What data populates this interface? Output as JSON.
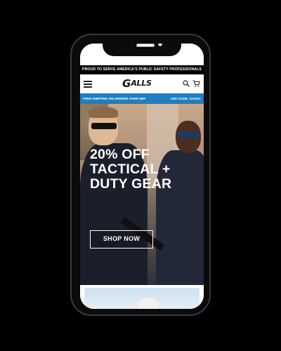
{
  "promo_banner": {
    "text": "PROUD TO SERVE AMERICA'S PUBLIC SAFETY PROFESSIONALS"
  },
  "header": {
    "logo": {
      "mark": "G",
      "text": "ALLS"
    },
    "menu_icon": "hamburger-icon",
    "search_icon": "search-icon",
    "cart_icon": "cart-icon"
  },
  "shipping_bar": {
    "left_text": "FREE SHIPPING ON ORDERS OVER $99*",
    "right_text": "USE CODE: GASEC",
    "color": "#1f7fc0"
  },
  "hero": {
    "title_lines": [
      "20% OFF",
      "TACTICAL +",
      "DUTY GEAR"
    ],
    "cta_label": "SHOP NOW"
  },
  "colors": {
    "background": "#000000",
    "phone_frame": "#0b0b0b",
    "accent": "#1f7fc0"
  }
}
